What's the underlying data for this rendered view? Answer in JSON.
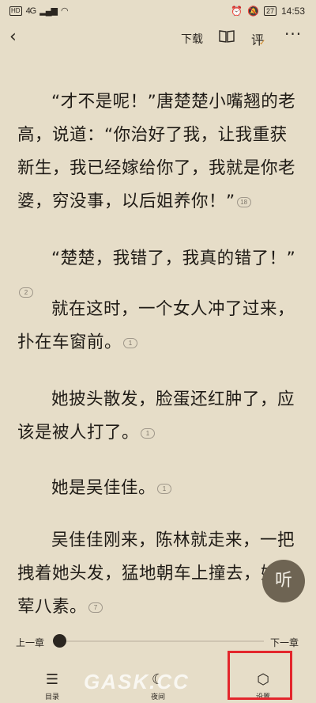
{
  "status_bar": {
    "left": [
      "HD",
      "4G",
      "📶",
      "📶"
    ],
    "battery": "27",
    "time": "14:53"
  },
  "toolbar": {
    "download_label": "下载",
    "comment_label": "评"
  },
  "paragraphs": [
    {
      "text": "“才不是呢！”唐楚楚小嘴翘的老高，说道：“你治好了我，让我重获新生，我已经嫁给你了，我就是你老婆，穷没事，以后姐养你！”",
      "comments": "18"
    },
    {
      "text": "“楚楚，我错了，我真的错了！”",
      "comments": "2"
    },
    {
      "text": "就在这时，一个女人冲了过来，扑在车窗前。",
      "comments": "1"
    },
    {
      "text": "她披头散发，脸蛋还红肿了，应该是被人打了。",
      "comments": "1"
    },
    {
      "text": "她是吴佳佳。",
      "comments": "1"
    },
    {
      "text": "吴佳佳刚来，陈林就走来，一把拽着她头发，猛地朝车上撞去，她七荤八素。",
      "comments": "7"
    }
  ],
  "listen_label": "听",
  "chapter_nav": {
    "prev": "上一章",
    "next": "下一章",
    "progress": 0.0
  },
  "bottom_nav": [
    {
      "label": "目录",
      "icon": "menu-icon"
    },
    {
      "label": "夜间",
      "icon": "moon-icon"
    },
    {
      "label": "设置",
      "icon": "settings-icon"
    }
  ],
  "watermark": "GASK.CC",
  "highlight_color": "#e3262c"
}
